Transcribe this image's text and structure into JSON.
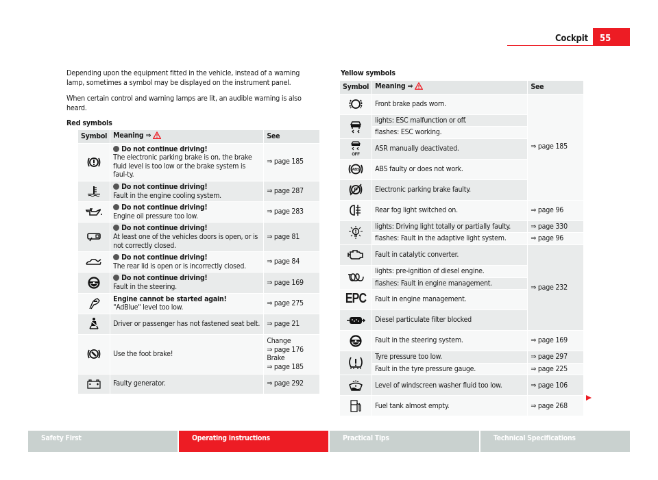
{
  "header": {
    "section_title": "Cockpit",
    "page_number": "55"
  },
  "intro": {
    "paragraph1_line1": "Depending upon the equipment fitted in the vehicle, instead of a warning",
    "paragraph1_line2": "lamp, sometimes a symbol may be displayed on the instrument panel.",
    "paragraph2_line1": "When certain control and warning lamps are lit, an audible warning is also",
    "paragraph2_line2": "heard."
  },
  "red_table": {
    "heading": "Red symbols",
    "columns": {
      "symbol": "Symbol",
      "meaning": "Meaning ⇒",
      "see": "See"
    },
    "rows": [
      {
        "icon": "brake-system-icon",
        "title": "Do not continue driving!",
        "text": "The electronic parking brake is on, the brake fluid level is too low or the brake system is faul-ty.",
        "see": "⇒ page 185"
      },
      {
        "icon": "coolant-temperature-icon",
        "title": "Do not continue driving!",
        "text": "Fault in the engine cooling system.",
        "see": "⇒ page 287"
      },
      {
        "icon": "oil-pressure-icon",
        "title": "Do not continue driving!",
        "text": "Engine oil pressure too low.",
        "see": "⇒ page 283"
      },
      {
        "icon": "door-open-icon",
        "title": "Do not continue driving!",
        "text": "At least one of the vehicles doors is open, or is not correctly closed.",
        "see": "⇒ page 81"
      },
      {
        "icon": "rear-lid-open-icon",
        "title": "Do not continue driving!",
        "text": "The rear lid is open or is incorrectly closed.",
        "see": "⇒ page 84"
      },
      {
        "icon": "steering-wheel-icon",
        "title": "Do not continue driving!",
        "text": "Fault in the steering.",
        "see": "⇒ page 169"
      },
      {
        "icon": "adblue-icon",
        "title": "Engine cannot be started again!",
        "text": "\"AdBlue\" level too low.",
        "see": "⇒ page 275"
      },
      {
        "icon": "seat-belt-icon",
        "title": "",
        "text": "Driver or passenger has not fastened seat belt.",
        "see": "⇒ page 21"
      },
      {
        "icon": "foot-brake-icon",
        "title": "",
        "text": "Use the foot brake!",
        "see_lines": [
          "Change",
          "⇒ page 176",
          "Brake",
          "⇒ page 185"
        ]
      },
      {
        "icon": "battery-icon",
        "title": "",
        "text": "Faulty generator.",
        "see": "⇒ page 292"
      }
    ]
  },
  "yellow_table": {
    "heading": "Yellow symbols",
    "columns": {
      "symbol": "Symbol",
      "meaning": "Meaning ⇒",
      "see": "See"
    },
    "group1_see": "⇒ page 185",
    "group2_see": "⇒ page 232",
    "rows": [
      {
        "icon": "brake-pads-icon",
        "text": "Front brake pads worn."
      },
      {
        "icon": "esc-icon",
        "text_a": "lights: ESC malfunction or off.",
        "text_b": "flashes: ESC working."
      },
      {
        "icon": "asr-off-icon",
        "text": "ASR manually deactivated."
      },
      {
        "icon": "abs-icon",
        "text": "ABS faulty or does not work."
      },
      {
        "icon": "parking-brake-faulty-icon",
        "text": "Electronic parking brake faulty.",
        "see": "⇒ page 185"
      },
      {
        "icon": "rear-fog-light-icon",
        "text": "Rear fog light switched on.",
        "see": "⇒ page 96"
      },
      {
        "icon": "bulb-fault-icon",
        "text_a": "lights: Driving light totally or partially faulty.",
        "see_a": "⇒ page 330",
        "text_b": "flashes: Fault in the adaptive light system.",
        "see_b": "⇒ page 96"
      },
      {
        "icon": "engine-check-icon",
        "text": "Fault in catalytic converter."
      },
      {
        "icon": "glow-plug-icon",
        "text_a": "lights: pre-ignition of diesel engine.",
        "text_b": "flashes: Fault in engine management."
      },
      {
        "icon": "epc-icon",
        "icon_text": "EPC",
        "text": "Fault in engine management."
      },
      {
        "icon": "particulate-filter-icon",
        "text": "Diesel particulate filter blocked"
      },
      {
        "icon": "steering-wheel-icon",
        "text": "Fault in the steering system.",
        "see": "⇒ page 169"
      },
      {
        "icon": "tyre-pressure-icon",
        "text_a": "Tyre pressure too low.",
        "see_a": "⇒ page 297",
        "text_b": "Fault in the tyre pressure gauge.",
        "see_b": "⇒ page 225"
      },
      {
        "icon": "washer-fluid-icon",
        "text": "Level of windscreen washer fluid too low.",
        "see": "⇒ page 106"
      },
      {
        "icon": "fuel-icon",
        "text": "Fuel tank almost empty.",
        "see": "⇒ page 268"
      }
    ]
  },
  "footer": {
    "tabs": [
      {
        "label": "Safety First",
        "active": false
      },
      {
        "label": "Operating instructions",
        "active": true
      },
      {
        "label": "Practical Tips",
        "active": false
      },
      {
        "label": "Technical Specifications",
        "active": false
      }
    ]
  },
  "colors": {
    "accent_red": "#ed1c24",
    "row_grey": "#e9ebeb",
    "row_light": "#f7f8f8",
    "footer_grey": "#c9d1cf"
  }
}
